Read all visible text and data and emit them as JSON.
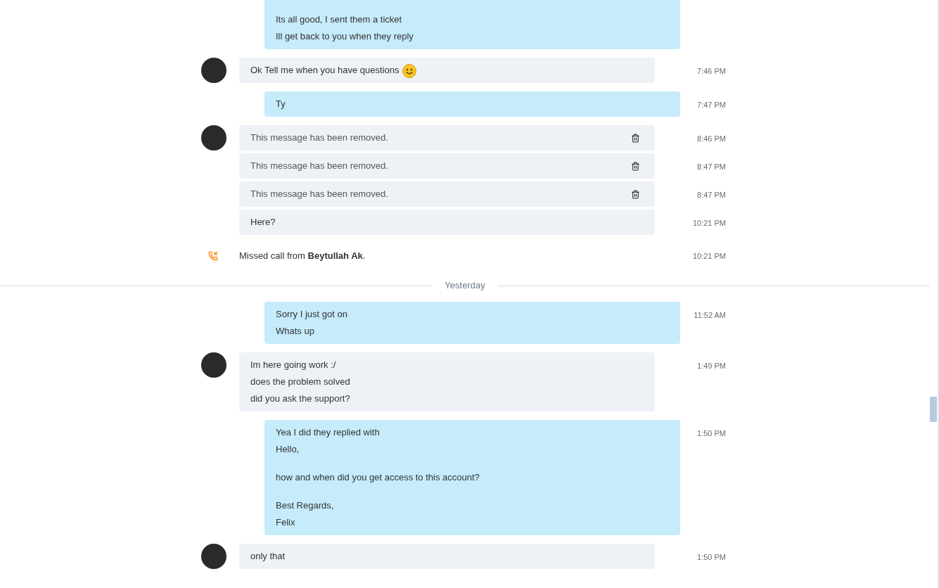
{
  "messages": [
    {
      "kind": "outgoing",
      "paragraphs": [
        [
          "Its all good, I sent them a ticket",
          "Ill get back to you when they reply"
        ]
      ]
    },
    {
      "kind": "incoming",
      "avatar": true,
      "emoji": true,
      "paragraphs": [
        [
          "Ok Tell me when you have questions"
        ]
      ],
      "time": "7:46 PM"
    },
    {
      "kind": "outgoing",
      "paragraphs": [
        [
          "Ty"
        ]
      ],
      "time": "7:47 PM"
    },
    {
      "kind": "removed",
      "avatar": true,
      "text": "This message has been removed.",
      "time": "8:46 PM"
    },
    {
      "kind": "removed",
      "avatar": false,
      "text": "This message has been removed.",
      "time": "8:47 PM"
    },
    {
      "kind": "removed",
      "avatar": false,
      "text": "This message has been removed.",
      "time": "8:47 PM"
    },
    {
      "kind": "incoming",
      "avatar": false,
      "emoji": false,
      "paragraphs": [
        [
          "Here?"
        ]
      ],
      "time": "10:21 PM"
    },
    {
      "kind": "call",
      "text": "Missed call from **Beytullah Ak**.",
      "time": "10:21 PM"
    },
    {
      "kind": "divider",
      "text": "Yesterday"
    },
    {
      "kind": "outgoing",
      "paragraphs": [
        [
          "Sorry I just got on",
          "Whats up"
        ]
      ],
      "time": "11:52 AM"
    },
    {
      "kind": "incoming",
      "avatar": true,
      "emoji": false,
      "paragraphs": [
        [
          "Im here going work :/",
          "does the problem solved",
          "did you ask the support?"
        ]
      ],
      "time": "1:49 PM"
    },
    {
      "kind": "outgoing",
      "paragraphs": [
        [
          "Yea I did they replied with",
          "Hello,"
        ],
        [
          "how and when did you get access to this account?"
        ],
        [
          "Best Regards,",
          "Felix"
        ]
      ],
      "time": "1:50 PM"
    },
    {
      "kind": "incoming",
      "avatar": true,
      "emoji": false,
      "paragraphs": [
        [
          "only that"
        ]
      ],
      "time": "1:50 PM"
    }
  ]
}
